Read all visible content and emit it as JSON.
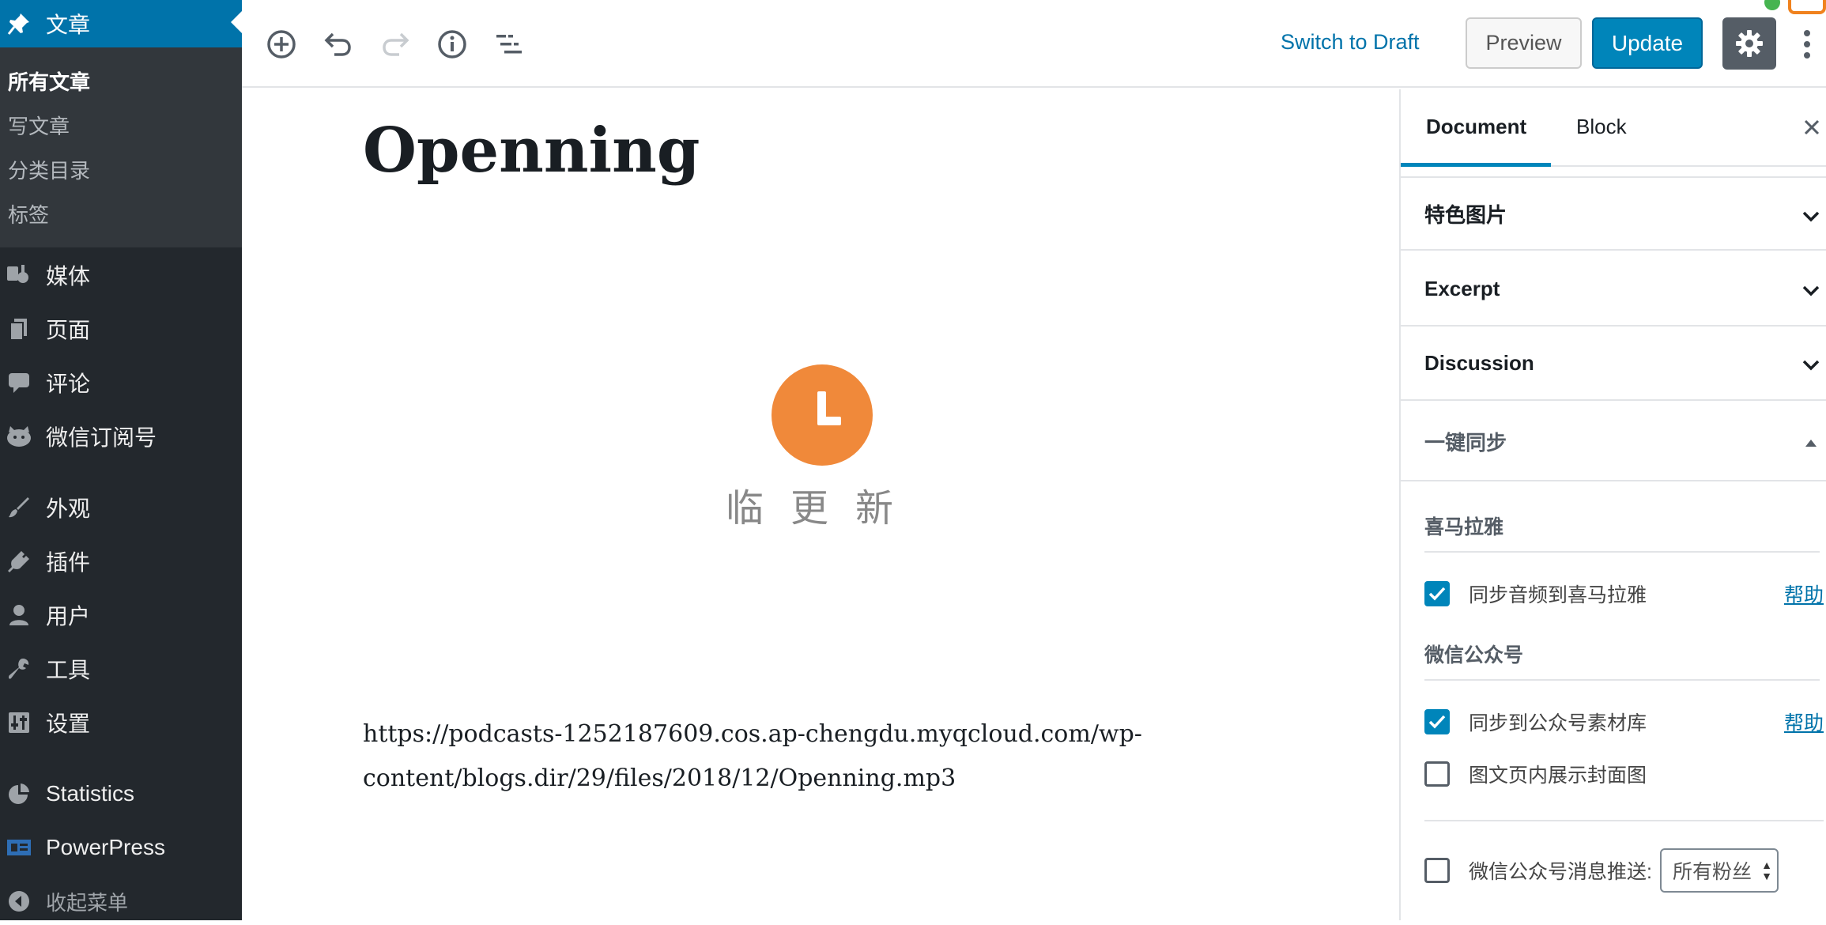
{
  "admin_menu": {
    "current": {
      "label": "文章",
      "icon": "pin-icon"
    },
    "submenu": [
      "所有文章",
      "写文章",
      "分类目录",
      "标签"
    ],
    "items": [
      {
        "label": "媒体",
        "icon": "media-icon"
      },
      {
        "label": "页面",
        "icon": "page-icon"
      },
      {
        "label": "评论",
        "icon": "comment-icon"
      },
      {
        "label": "微信订阅号",
        "icon": "wechat-icon"
      },
      {
        "label": "外观",
        "icon": "paintbrush-icon"
      },
      {
        "label": "插件",
        "icon": "plugin-icon"
      },
      {
        "label": "用户",
        "icon": "user-icon"
      },
      {
        "label": "工具",
        "icon": "wrench-icon"
      },
      {
        "label": "设置",
        "icon": "settings-sliders-icon"
      },
      {
        "label": "Statistics",
        "icon": "pie-chart-icon"
      },
      {
        "label": "PowerPress",
        "icon": "powerpress-icon"
      },
      {
        "label": "收起菜单",
        "icon": "collapse-icon"
      }
    ]
  },
  "toolbar": {
    "switch_to_draft": "Switch to Draft",
    "preview": "Preview",
    "update": "Update",
    "accent": "#0085ba"
  },
  "editor": {
    "title": "Openning",
    "logo_text": "临更新",
    "audio_url": "https://podcasts-1252187609.cos.ap-chengdu.myqcloud.com/wp-content/blogs.dir/29/files/2018/12/Openning.mp3"
  },
  "sidebar": {
    "tabs": [
      "Document",
      "Block"
    ],
    "panels": [
      "特色图片",
      "Excerpt",
      "Discussion",
      "一键同步"
    ],
    "sync": {
      "ximalaya_heading": "喜马拉雅",
      "ximalaya_option": "同步音频到喜马拉雅",
      "ximalaya_checked": true,
      "wechat_heading": "微信公众号",
      "wechat_option": "同步到公众号素材库",
      "wechat_checked": true,
      "cover_option": "图文页内展示封面图",
      "cover_checked": false,
      "push_option": "微信公众号消息推送:",
      "push_checked": false,
      "push_select": "所有粉丝",
      "help": "帮助"
    }
  }
}
